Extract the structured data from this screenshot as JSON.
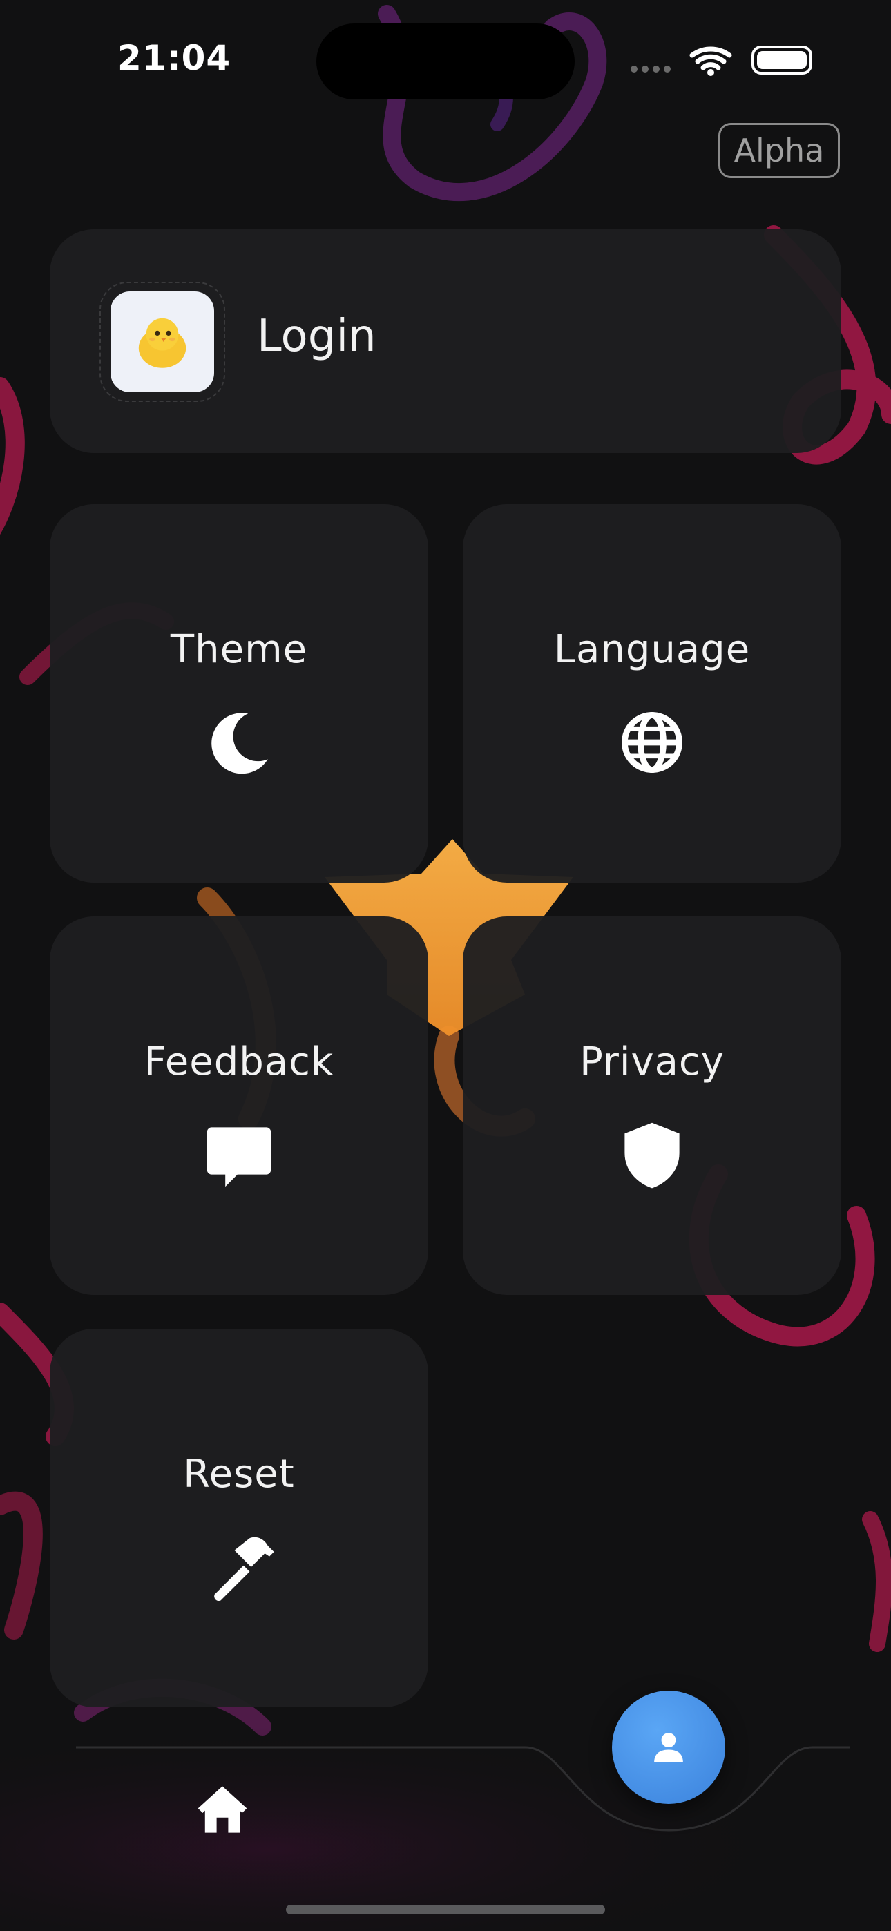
{
  "status_bar": {
    "time": "21:04"
  },
  "badge": {
    "label": "Alpha"
  },
  "login": {
    "label": "Login",
    "avatar_emoji": "🐥"
  },
  "tiles": [
    {
      "label": "Theme",
      "icon": "moon-icon"
    },
    {
      "label": "Language",
      "icon": "globe-icon"
    },
    {
      "label": "Feedback",
      "icon": "chat-bubble-icon"
    },
    {
      "label": "Privacy",
      "icon": "shield-icon"
    },
    {
      "label": "Reset",
      "icon": "hammer-icon"
    }
  ],
  "tab_bar": {
    "items": [
      {
        "icon": "home-icon"
      },
      {
        "icon": "profile-icon"
      }
    ]
  },
  "colors": {
    "accent": "#3b82dc",
    "card": "#1e1e20",
    "background": "#111112"
  }
}
